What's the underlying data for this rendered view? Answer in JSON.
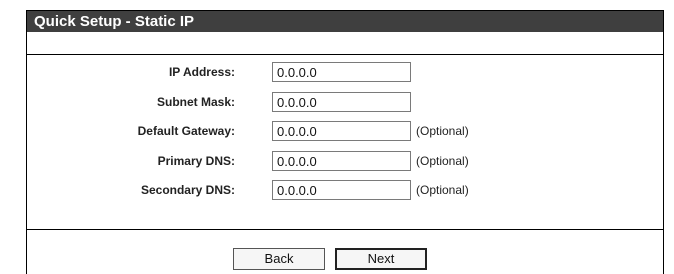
{
  "header": {
    "title": "Quick Setup - Static IP"
  },
  "form": {
    "fields": [
      {
        "label": "IP Address:",
        "value": "0.0.0.0",
        "note": ""
      },
      {
        "label": "Subnet Mask:",
        "value": "0.0.0.0",
        "note": ""
      },
      {
        "label": "Default Gateway:",
        "value": "0.0.0.0",
        "note": "(Optional)"
      },
      {
        "label": "Primary DNS:",
        "value": "0.0.0.0",
        "note": "(Optional)"
      },
      {
        "label": "Secondary DNS:",
        "value": "0.0.0.0",
        "note": "(Optional)"
      }
    ]
  },
  "buttons": {
    "back_label": "Back",
    "next_label": "Next"
  }
}
